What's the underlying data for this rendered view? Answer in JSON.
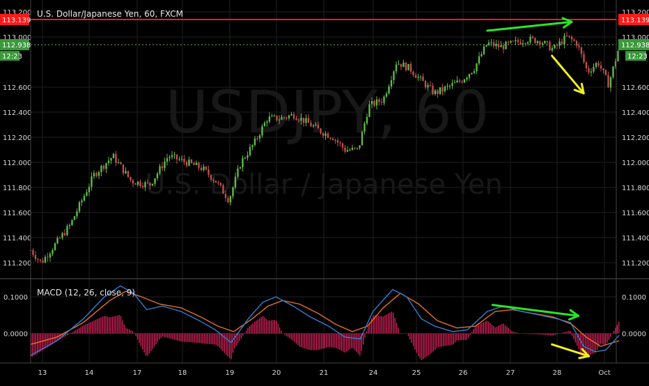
{
  "header": {
    "symbol_title": "U.S. Dollar/Japanese Yen, 60, FXCM",
    "watermark_symbol": "USDJPY, 60",
    "watermark_name": "U.S. Dollar / Japanese Yen"
  },
  "colors": {
    "background": "#000000",
    "grid": "#1f1f1f",
    "axis_text": "#d9d9d9",
    "candle_up": "#5fb94a",
    "candle_down": "#c0504d",
    "resistance": "#ff1a1a",
    "price_badge": "#3a9a3a",
    "macd_line": "#2f7fd1",
    "signal_line": "#e8702a",
    "histogram": "#e0245e",
    "arrow_green": "#29e629",
    "arrow_yellow": "#f0f01e"
  },
  "chart_data": [
    {
      "type": "candlestick",
      "title": "U.S. Dollar/Japanese Yen, 60, FXCM",
      "yaxis_ticks": [
        113.2,
        113.0,
        112.6,
        112.4,
        112.2,
        112.0,
        111.8,
        111.6,
        111.4,
        111.2
      ],
      "yaxis_tick_labels": [
        "113.200",
        "113.000",
        "112.600",
        "112.400",
        "112.200",
        "112.000",
        "111.800",
        "111.600",
        "111.400",
        "111.200"
      ],
      "ylim": [
        111.1,
        113.25
      ],
      "xaxis_tick_labels": [
        "13",
        "14",
        "17",
        "18",
        "19",
        "20",
        "21",
        "24",
        "25",
        "26",
        "27",
        "28",
        "Oct"
      ],
      "grid": true,
      "reference_lines": [
        {
          "name": "resistance",
          "value": 113.139,
          "label": "113.139"
        },
        {
          "name": "last-price",
          "value": 112.938,
          "label": "112.938"
        }
      ],
      "countdown_label": "12:23",
      "path_anchors": [
        {
          "x": 0,
          "price": 111.3
        },
        {
          "x": 13.7,
          "price": 111.2
        },
        {
          "x": 51.6,
          "price": 111.5
        },
        {
          "x": 82.7,
          "price": 111.9
        },
        {
          "x": 107.4,
          "price": 112.05
        },
        {
          "x": 131.4,
          "price": 111.85
        },
        {
          "x": 155.5,
          "price": 111.82
        },
        {
          "x": 179.6,
          "price": 112.05
        },
        {
          "x": 203.7,
          "price": 112.0
        },
        {
          "x": 224.5,
          "price": 111.95
        },
        {
          "x": 241.7,
          "price": 111.85
        },
        {
          "x": 258.9,
          "price": 111.7
        },
        {
          "x": 274.4,
          "price": 112.0
        },
        {
          "x": 291.6,
          "price": 112.15
        },
        {
          "x": 308.9,
          "price": 112.35
        },
        {
          "x": 326.1,
          "price": 112.35
        },
        {
          "x": 343.3,
          "price": 112.38
        },
        {
          "x": 360.5,
          "price": 112.32
        },
        {
          "x": 377.7,
          "price": 112.25
        },
        {
          "x": 394.9,
          "price": 112.2
        },
        {
          "x": 410.4,
          "price": 112.1
        },
        {
          "x": 427.6,
          "price": 112.1
        },
        {
          "x": 441.4,
          "price": 112.45
        },
        {
          "x": 460.3,
          "price": 112.5
        },
        {
          "x": 477.5,
          "price": 112.8
        },
        {
          "x": 494.7,
          "price": 112.75
        },
        {
          "x": 510.2,
          "price": 112.65
        },
        {
          "x": 527.4,
          "price": 112.55
        },
        {
          "x": 544.6,
          "price": 112.6
        },
        {
          "x": 561.8,
          "price": 112.65
        },
        {
          "x": 579.0,
          "price": 112.75
        },
        {
          "x": 596.2,
          "price": 112.95
        },
        {
          "x": 613.4,
          "price": 112.92
        },
        {
          "x": 630.6,
          "price": 112.95
        },
        {
          "x": 647.8,
          "price": 112.98
        },
        {
          "x": 665.1,
          "price": 112.97
        },
        {
          "x": 682.3,
          "price": 112.9
        },
        {
          "x": 699.5,
          "price": 113.0
        },
        {
          "x": 713.2,
          "price": 112.95
        },
        {
          "x": 727.0,
          "price": 112.72
        },
        {
          "x": 740.8,
          "price": 112.8
        },
        {
          "x": 754.5,
          "price": 112.62
        },
        {
          "x": 768.3,
          "price": 112.92
        }
      ],
      "annotations": [
        {
          "type": "arrow",
          "color": "green",
          "from": {
            "x": 596.2,
            "price": 113.05
          },
          "to": {
            "x": 706.4,
            "price": 113.12
          }
        },
        {
          "type": "arrow",
          "color": "yellow",
          "from": {
            "x": 680.6,
            "price": 112.85
          },
          "to": {
            "x": 722.0,
            "price": 112.55
          }
        }
      ]
    },
    {
      "type": "line",
      "title": "MACD (12, 26, close, 9)",
      "yaxis_ticks": [
        0.1,
        0.0
      ],
      "yaxis_tick_labels": [
        "0.1000",
        "0.0000"
      ],
      "ylim": [
        -0.075,
        0.14
      ],
      "series": [
        {
          "name": "MACD",
          "points": [
            {
              "x": 0,
              "v": -0.06
            },
            {
              "x": 34.4,
              "v": -0.02
            },
            {
              "x": 68.9,
              "v": 0.04
            },
            {
              "x": 96.4,
              "v": 0.1
            },
            {
              "x": 117.1,
              "v": 0.13
            },
            {
              "x": 134.3,
              "v": 0.11
            },
            {
              "x": 151.5,
              "v": 0.065
            },
            {
              "x": 172.2,
              "v": 0.075
            },
            {
              "x": 196.3,
              "v": 0.06
            },
            {
              "x": 220.3,
              "v": 0.035
            },
            {
              "x": 241.0,
              "v": 0.01
            },
            {
              "x": 261.7,
              "v": -0.025
            },
            {
              "x": 284.1,
              "v": 0.04
            },
            {
              "x": 303.0,
              "v": 0.085
            },
            {
              "x": 320.2,
              "v": 0.1
            },
            {
              "x": 342.6,
              "v": 0.075
            },
            {
              "x": 365.0,
              "v": 0.045
            },
            {
              "x": 389.1,
              "v": 0.02
            },
            {
              "x": 410.4,
              "v": -0.01
            },
            {
              "x": 430.4,
              "v": -0.015
            },
            {
              "x": 446.9,
              "v": 0.06
            },
            {
              "x": 472.7,
              "v": 0.12
            },
            {
              "x": 491.0,
              "v": 0.1
            },
            {
              "x": 510.2,
              "v": 0.04
            },
            {
              "x": 527.4,
              "v": 0.02
            },
            {
              "x": 551.5,
              "v": 0.005
            },
            {
              "x": 570.4,
              "v": 0.01
            },
            {
              "x": 596.2,
              "v": 0.06
            },
            {
              "x": 616.9,
              "v": 0.075
            },
            {
              "x": 641.0,
              "v": 0.06
            },
            {
              "x": 665.1,
              "v": 0.05
            },
            {
              "x": 687.4,
              "v": 0.04
            },
            {
              "x": 704.6,
              "v": 0.03
            },
            {
              "x": 721.9,
              "v": -0.035
            },
            {
              "x": 737.3,
              "v": -0.05
            },
            {
              "x": 751.1,
              "v": -0.045
            },
            {
              "x": 768.3,
              "v": -0.005
            }
          ]
        },
        {
          "name": "Signal",
          "points": [
            {
              "x": 0,
              "v": -0.03
            },
            {
              "x": 34.4,
              "v": -0.01
            },
            {
              "x": 68.9,
              "v": 0.03
            },
            {
              "x": 103.3,
              "v": 0.09
            },
            {
              "x": 123.9,
              "v": 0.115
            },
            {
              "x": 144.6,
              "v": 0.1
            },
            {
              "x": 168.7,
              "v": 0.08
            },
            {
              "x": 196.3,
              "v": 0.07
            },
            {
              "x": 222.1,
              "v": 0.045
            },
            {
              "x": 244.5,
              "v": 0.02
            },
            {
              "x": 265.1,
              "v": 0.005
            },
            {
              "x": 289.2,
              "v": 0.04
            },
            {
              "x": 310.0,
              "v": 0.075
            },
            {
              "x": 329.0,
              "v": 0.09
            },
            {
              "x": 351.2,
              "v": 0.08
            },
            {
              "x": 375.3,
              "v": 0.055
            },
            {
              "x": 398.1,
              "v": 0.025
            },
            {
              "x": 420.0,
              "v": 0.005
            },
            {
              "x": 439.7,
              "v": 0.02
            },
            {
              "x": 460.3,
              "v": 0.07
            },
            {
              "x": 482.7,
              "v": 0.11
            },
            {
              "x": 506.7,
              "v": 0.08
            },
            {
              "x": 530.8,
              "v": 0.035
            },
            {
              "x": 556.6,
              "v": 0.015
            },
            {
              "x": 580.7,
              "v": 0.02
            },
            {
              "x": 606.5,
              "v": 0.06
            },
            {
              "x": 629.0,
              "v": 0.065
            },
            {
              "x": 655.0,
              "v": 0.055
            },
            {
              "x": 682.3,
              "v": 0.045
            },
            {
              "x": 706.4,
              "v": 0.025
            },
            {
              "x": 725.3,
              "v": -0.01
            },
            {
              "x": 744.2,
              "v": -0.035
            },
            {
              "x": 768.3,
              "v": -0.02
            }
          ]
        }
      ],
      "annotations": [
        {
          "type": "arrow",
          "color": "green",
          "from": {
            "x": 603.0,
            "v": 0.078
          },
          "to": {
            "x": 715.0,
            "v": 0.048
          }
        },
        {
          "type": "arrow",
          "color": "yellow",
          "from": {
            "x": 680.6,
            "v": -0.03
          },
          "to": {
            "x": 728.7,
            "v": -0.062
          }
        }
      ]
    }
  ]
}
